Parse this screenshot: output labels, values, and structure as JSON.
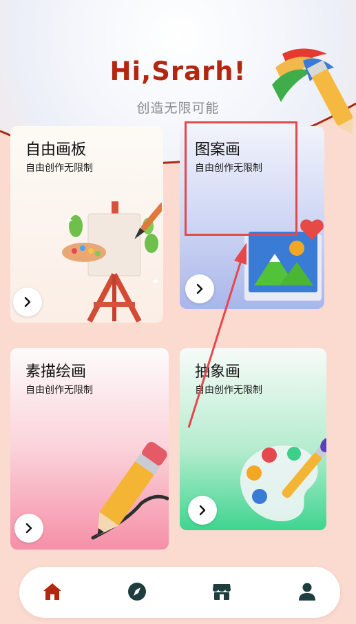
{
  "header": {
    "greeting": "Hi,Srarh!",
    "tagline": "创造无限可能"
  },
  "cards": [
    {
      "title": "自由画板",
      "subtitle": "自由创作无限制"
    },
    {
      "title": "图案画",
      "subtitle": "自由创作无限制"
    },
    {
      "title": "素描绘画",
      "subtitle": "自由创作无限制"
    },
    {
      "title": "抽象画",
      "subtitle": "自由创作无限制"
    }
  ],
  "tabbar": {
    "items": [
      {
        "icon": "home-icon",
        "active": true
      },
      {
        "icon": "compass-icon",
        "active": false
      },
      {
        "icon": "store-icon",
        "active": false
      },
      {
        "icon": "user-icon",
        "active": false
      }
    ]
  },
  "colors": {
    "accent": "#b3260f",
    "annotation": "#e6474b",
    "tab_icon": "#1e3d3f"
  }
}
